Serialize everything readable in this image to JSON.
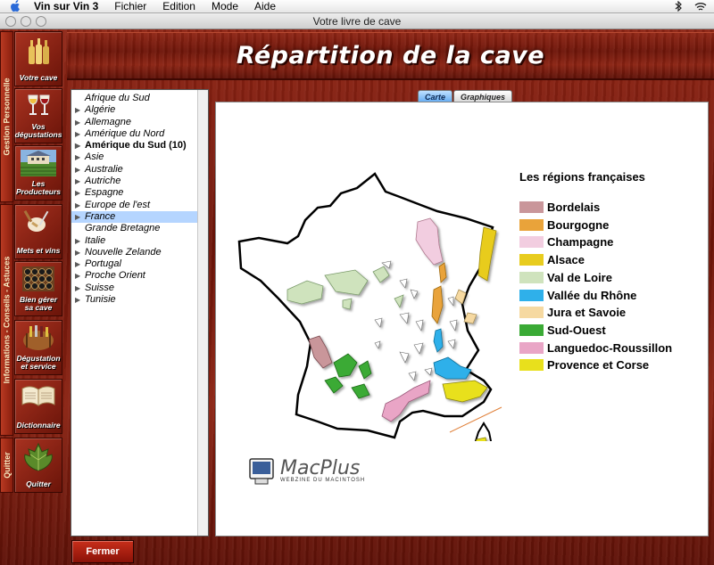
{
  "menubar": {
    "app_name": "Vin sur Vin 3",
    "menus": [
      "Fichier",
      "Edition",
      "Mode",
      "Aide"
    ],
    "icons": [
      "apple-icon",
      "bluetooth-icon",
      "wifi-icon"
    ]
  },
  "window": {
    "title": "Votre livre de cave"
  },
  "sidebar": {
    "sections": [
      "Gestion Personnelle",
      "Informations - Conseils - Astuces",
      "Quitter"
    ],
    "buttons": [
      {
        "label": "Votre cave",
        "icon": "wine-bottles-icon"
      },
      {
        "label": "Vos dégustations",
        "icon": "wine-glasses-icon"
      },
      {
        "label": "Les Producteurs",
        "icon": "chateau-icon"
      },
      {
        "label": "Mets et vins",
        "icon": "meat-fork-icon"
      },
      {
        "label": "Bien gérer sa cave",
        "icon": "wine-rack-icon"
      },
      {
        "label": "Dégustation et service",
        "icon": "wine-barrel-icon"
      },
      {
        "label": "Dictionnaire",
        "icon": "book-icon"
      },
      {
        "label": "Quitter",
        "icon": "vine-leaf-icon"
      }
    ]
  },
  "header": {
    "title": "Répartition de la cave"
  },
  "countries": [
    {
      "name": "Afrique du Sud",
      "arrow": false,
      "style": "italic"
    },
    {
      "name": "Algérie",
      "arrow": true,
      "style": "italic"
    },
    {
      "name": "Allemagne",
      "arrow": true,
      "style": "italic"
    },
    {
      "name": "Amérique du Nord",
      "arrow": true,
      "style": "italic"
    },
    {
      "name": "Amérique du Sud (10)",
      "arrow": true,
      "style": "bold"
    },
    {
      "name": "Asie",
      "arrow": true,
      "style": "italic"
    },
    {
      "name": "Australie",
      "arrow": true,
      "style": "italic"
    },
    {
      "name": "Autriche",
      "arrow": true,
      "style": "italic"
    },
    {
      "name": "Espagne",
      "arrow": true,
      "style": "italic"
    },
    {
      "name": "Europe de l'est",
      "arrow": true,
      "style": "italic"
    },
    {
      "name": "France",
      "arrow": true,
      "style": "italic",
      "selected": true
    },
    {
      "name": "Grande Bretagne",
      "arrow": false,
      "style": "italic"
    },
    {
      "name": "Italie",
      "arrow": true,
      "style": "italic"
    },
    {
      "name": "Nouvelle Zelande",
      "arrow": true,
      "style": "italic"
    },
    {
      "name": "Portugal",
      "arrow": true,
      "style": "italic"
    },
    {
      "name": "Proche Orient",
      "arrow": true,
      "style": "italic"
    },
    {
      "name": "Suisse",
      "arrow": true,
      "style": "italic"
    },
    {
      "name": "Tunisie",
      "arrow": true,
      "style": "italic"
    }
  ],
  "tabs": [
    {
      "label": "Carte",
      "active": true
    },
    {
      "label": "Graphiques",
      "active": false
    }
  ],
  "legend": {
    "title": "Les régions françaises",
    "items": [
      {
        "label": "Bordelais",
        "color": "#c9969a"
      },
      {
        "label": "Bourgogne",
        "color": "#e9a33a"
      },
      {
        "label": "Champagne",
        "color": "#f2cde0"
      },
      {
        "label": "Alsace",
        "color": "#e8cc1e"
      },
      {
        "label": "Val de Loire",
        "color": "#cfe3bd"
      },
      {
        "label": "Vallée du Rhône",
        "color": "#2fb0ea"
      },
      {
        "label": "Jura et Savoie",
        "color": "#f6d9a1"
      },
      {
        "label": "Sud-Ouest",
        "color": "#3aaa35"
      },
      {
        "label": "Languedoc-Roussillon",
        "color": "#e9a5c6"
      },
      {
        "label": "Provence et Corse",
        "color": "#e8e01c"
      }
    ]
  },
  "logo": {
    "name": "MacPlus",
    "tagline": "WEBZINE DU MACINTOSH"
  },
  "footer": {
    "close_label": "Fermer"
  }
}
